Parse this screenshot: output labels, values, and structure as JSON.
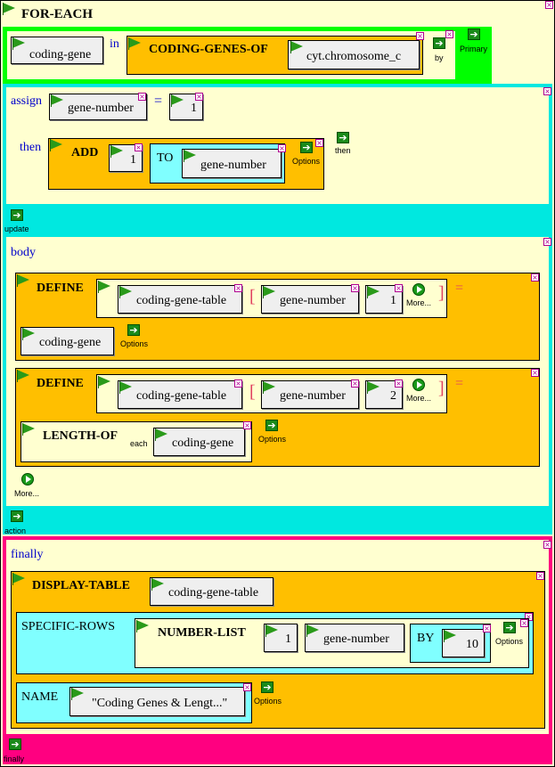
{
  "for_each": {
    "keyword": "FOR-EACH",
    "primary": {
      "var": "coding-gene",
      "in_label": "in",
      "func": "CODING-GENES-OF",
      "arg": "cyt.chromosome_c",
      "by_label": "by",
      "primary_label": "Primary"
    },
    "init": {
      "assign_label": "assign",
      "var": "gene-number",
      "eq": "=",
      "value": "1",
      "then_label": "then",
      "add_keyword": "ADD",
      "add_value": "1",
      "to_label": "TO",
      "add_target": "gene-number",
      "options_label": "Options",
      "then_btn_label": "then"
    },
    "update_label": "update",
    "body": {
      "label": "body",
      "define1": {
        "keyword": "DEFINE",
        "table": "coding-gene-table",
        "lbracket": "[",
        "rbracket": "]",
        "index1": "gene-number",
        "index2": "1",
        "more_label": "More...",
        "eq": "=",
        "value": "coding-gene",
        "options_label": "Options"
      },
      "define2": {
        "keyword": "DEFINE",
        "table": "coding-gene-table",
        "lbracket": "[",
        "rbracket": "]",
        "index1": "gene-number",
        "index2": "2",
        "more_label": "More...",
        "eq": "=",
        "length_keyword": "LENGTH-OF",
        "each_label": "each",
        "length_arg": "coding-gene",
        "options_label": "Options"
      },
      "more_label": "More..."
    },
    "action_label": "action",
    "finally": {
      "label": "finally",
      "display_keyword": "DISPLAY-TABLE",
      "table": "coding-gene-table",
      "specific_rows_label": "SPECIFIC-ROWS",
      "number_list_keyword": "NUMBER-LIST",
      "nl_start": "1",
      "nl_end": "gene-number",
      "by_label": "BY",
      "by_value": "10",
      "nl_options_label": "Options",
      "name_label": "NAME",
      "name_value": "\"Coding Genes & Lengt...\"",
      "name_options_label": "Options"
    },
    "finally_btn_label": "finally"
  },
  "colors": {
    "cream": "#ffffd0",
    "orange": "#ffbf00",
    "cyan": "#00e8e0",
    "light_cyan": "#80ffff",
    "green": "#00ff00",
    "pink": "#ff0080",
    "flag_green": "#2a9a1a",
    "label_blue": "#0000cc",
    "bracket_red": "#e04060"
  },
  "icons": {
    "flag": "green-flag-icon",
    "close": "close-x-icon",
    "go": "green-arrow-button-icon",
    "more": "green-play-circle-icon"
  }
}
